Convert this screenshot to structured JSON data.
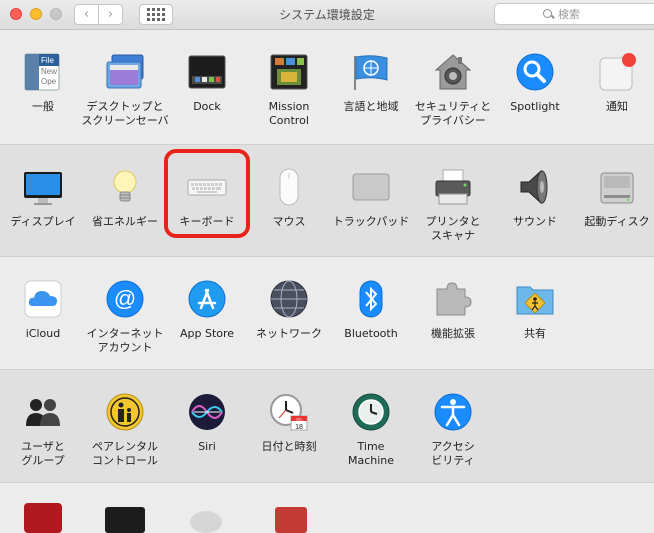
{
  "window": {
    "title": "システム環境設定"
  },
  "search": {
    "placeholder": "検索"
  },
  "rows": [
    {
      "items": [
        {
          "label": "一般"
        },
        {
          "label": "デスクトップと\nスクリーンセーバ"
        },
        {
          "label": "Dock"
        },
        {
          "label": "Mission\nControl"
        },
        {
          "label": "言語と地域"
        },
        {
          "label": "セキュリティと\nプライバシー"
        },
        {
          "label": "Spotlight"
        },
        {
          "label": "通知"
        }
      ]
    },
    {
      "items": [
        {
          "label": "ディスプレイ"
        },
        {
          "label": "省エネルギー"
        },
        {
          "label": "キーボード"
        },
        {
          "label": "マウス"
        },
        {
          "label": "トラックパッド"
        },
        {
          "label": "プリンタと\nスキャナ"
        },
        {
          "label": "サウンド"
        },
        {
          "label": "起動ディスク"
        }
      ]
    },
    {
      "items": [
        {
          "label": "iCloud"
        },
        {
          "label": "インターネット\nアカウント"
        },
        {
          "label": "App Store"
        },
        {
          "label": "ネットワーク"
        },
        {
          "label": "Bluetooth"
        },
        {
          "label": "機能拡張"
        },
        {
          "label": "共有"
        }
      ]
    },
    {
      "items": [
        {
          "label": "ユーザと\nグループ"
        },
        {
          "label": "ペアレンタル\nコントロール"
        },
        {
          "label": "Siri"
        },
        {
          "label": "日付と時刻"
        },
        {
          "label": "Time\nMachine"
        },
        {
          "label": "アクセシ\nビリティ"
        }
      ]
    }
  ],
  "general_icon_text": [
    "File",
    "New",
    "Ope"
  ],
  "calendar_icon": {
    "month": "JUL",
    "day": "18"
  },
  "highlighted_item": "キーボード",
  "colors": {
    "highlight": "#e8241a",
    "accent": "#1a8cff"
  }
}
